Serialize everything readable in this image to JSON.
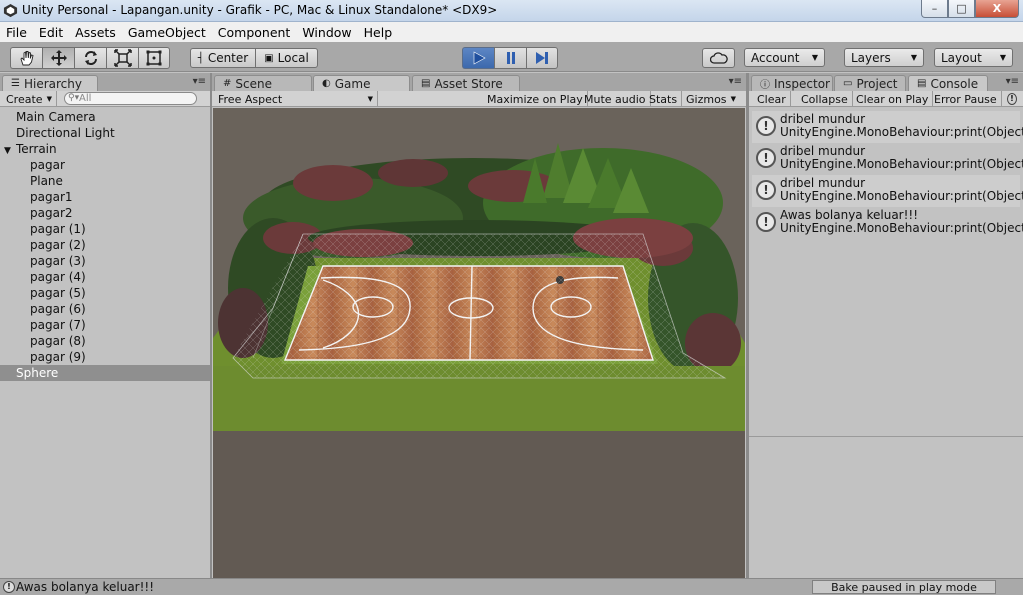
{
  "window": {
    "title": "Unity Personal - Lapangan.unity - Grafik - PC, Mac & Linux Standalone* <DX9>",
    "minimize": "–",
    "maximize": "□",
    "close": "X"
  },
  "menu": [
    "File",
    "Edit",
    "Assets",
    "GameObject",
    "Component",
    "Window",
    "Help"
  ],
  "toolbar": {
    "tools": [
      "hand-tool-icon",
      "move-tool-icon",
      "rotate-tool-icon",
      "scale-tool-icon",
      "rect-tool-icon"
    ],
    "pivot_label": "Center",
    "space_label": "Local",
    "account_label": "Account",
    "layers_label": "Layers",
    "layout_label": "Layout"
  },
  "hierarchy": {
    "tab_label": "Hierarchy",
    "create_label": "Create",
    "search_placeholder": "All",
    "items": [
      {
        "label": "Main Camera",
        "depth": 0,
        "expander": ""
      },
      {
        "label": "Directional Light",
        "depth": 0,
        "expander": ""
      },
      {
        "label": "Terrain",
        "depth": 0,
        "expander": "▼"
      },
      {
        "label": "pagar",
        "depth": 1,
        "expander": ""
      },
      {
        "label": "Plane",
        "depth": 1,
        "expander": ""
      },
      {
        "label": "pagar1",
        "depth": 1,
        "expander": ""
      },
      {
        "label": "pagar2",
        "depth": 1,
        "expander": ""
      },
      {
        "label": "pagar (1)",
        "depth": 1,
        "expander": ""
      },
      {
        "label": "pagar (2)",
        "depth": 1,
        "expander": ""
      },
      {
        "label": "pagar (3)",
        "depth": 1,
        "expander": ""
      },
      {
        "label": "pagar (4)",
        "depth": 1,
        "expander": ""
      },
      {
        "label": "pagar (5)",
        "depth": 1,
        "expander": ""
      },
      {
        "label": "pagar (6)",
        "depth": 1,
        "expander": ""
      },
      {
        "label": "pagar (7)",
        "depth": 1,
        "expander": ""
      },
      {
        "label": "pagar (8)",
        "depth": 1,
        "expander": ""
      },
      {
        "label": "pagar (9)",
        "depth": 1,
        "expander": ""
      },
      {
        "label": "Sphere",
        "depth": 0,
        "expander": "",
        "selected": true
      }
    ]
  },
  "center": {
    "tabs": [
      "Scene",
      "Game",
      "Asset Store"
    ],
    "active_tab": "Game",
    "aspect_label": "Free Aspect",
    "maximize_label": "Maximize on Play",
    "mute_label": "Mute audio",
    "stats_label": "Stats",
    "gizmos_label": "Gizmos"
  },
  "right": {
    "tabs": [
      "Inspector",
      "Project",
      "Console"
    ],
    "active_tab": "Console",
    "clear_label": "Clear",
    "collapse_label": "Collapse",
    "clear_on_play_label": "Clear on Play",
    "error_pause_label": "Error Pause",
    "logs": [
      {
        "line1": "dribel mundur",
        "line2": "UnityEngine.MonoBehaviour:print(Object)"
      },
      {
        "line1": "dribel mundur",
        "line2": "UnityEngine.MonoBehaviour:print(Object)"
      },
      {
        "line1": "dribel mundur",
        "line2": "UnityEngine.MonoBehaviour:print(Object)"
      },
      {
        "line1": "Awas bolanya keluar!!!",
        "line2": "UnityEngine.MonoBehaviour:print(Object)"
      }
    ]
  },
  "status": {
    "message": "Awas bolanya keluar!!!",
    "bake": "Bake paused in play mode"
  },
  "colors": {
    "play_blue": "#3c69ad",
    "court_wood": "#b8734a",
    "grass": "#6f8f2e",
    "tree_dark": "#2f4a24",
    "tree_red": "#6b3a3a"
  }
}
